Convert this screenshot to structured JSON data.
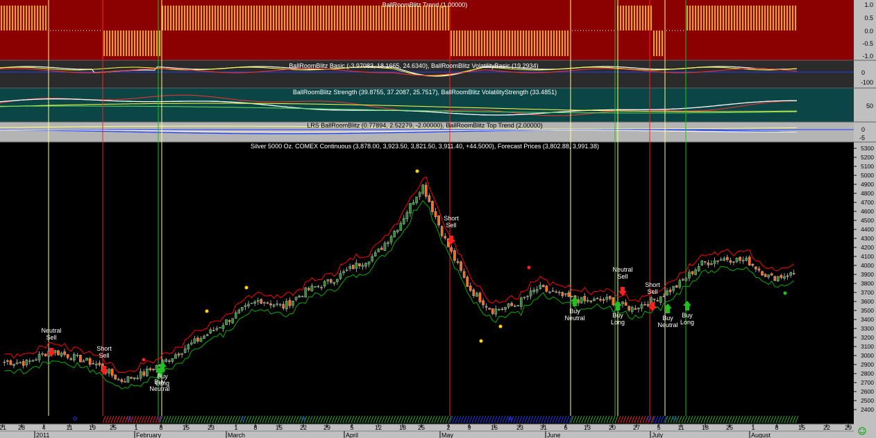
{
  "panels": {
    "trend": {
      "title": "BallRoomBlitz Trend (1.00000)",
      "scale": [
        "1.0",
        "0.5",
        "0.0",
        "-0.5",
        "-1.0"
      ],
      "bg": "#8b0000"
    },
    "basic": {
      "title": "BallRoomBlitz Basic (-3.97083, 18.1665, 24.6340), BallRoomBlitz VolatilityBasic (19.2934)",
      "scale": [
        "0",
        "-100"
      ],
      "bg": "#2b2b2b"
    },
    "strength": {
      "title": "BallRoomBlitz Strength (39.8755, 37.2087, 25.7517), BallRoomBlitz VolatilityStrength (33.4851)",
      "scale": [
        "50"
      ],
      "bg": "#0c4545"
    },
    "lrs": {
      "title": "LRS BallRoomBlitz (0.77894, 2.52279, -2.00000), BallRoomBlitz Top Trend (2.00000)",
      "scale": [
        "0",
        "-5"
      ],
      "bg": "#b4b4b4"
    }
  },
  "price": {
    "title": "Silver 5000 Oz. COMEX Continuous (3,878.00, 3,923.50, 3,821.50, 3,911.40, +44.5000), Forecast Prices (3,802.88, 3,991.38)",
    "yticks": [
      "5300",
      "5200",
      "5100",
      "5000",
      "4900",
      "4800",
      "4700",
      "4600",
      "4500",
      "4400",
      "4300",
      "4200",
      "4100",
      "4000",
      "3900",
      "3800",
      "3700",
      "3600",
      "3500",
      "3400",
      "3300",
      "3200",
      "3100",
      "3000",
      "2900",
      "2800",
      "2700",
      "2600",
      "2500",
      "2400"
    ]
  },
  "xaxis": {
    "day_ticks": [
      "21",
      "28",
      "4",
      "11",
      "19",
      "25",
      "1",
      "8",
      "15",
      "23",
      "1",
      "8",
      "15",
      "22",
      "29",
      "5",
      "12",
      "18",
      "25",
      "2",
      "9",
      "16",
      "23",
      "31",
      "6",
      "13",
      "20",
      "27",
      "5",
      "11",
      "18",
      "25",
      "1",
      "8",
      "15",
      "22",
      "29"
    ],
    "month_labels": [
      "2011",
      "February",
      "March",
      "April",
      "May",
      "June",
      "July",
      "August"
    ]
  },
  "signals": [
    {
      "id": "neutral-sell-1",
      "lines": [
        "Neutral",
        "Sell"
      ]
    },
    {
      "id": "short-sell-1",
      "lines": [
        "Short",
        "Sell"
      ]
    },
    {
      "id": "buy-neutral-1",
      "lines": [
        "Buy",
        "Neutral"
      ]
    },
    {
      "id": "buy-long-1",
      "lines": [
        "Buy",
        "Long"
      ]
    },
    {
      "id": "short-sell-2",
      "lines": [
        "Short",
        "Sell"
      ]
    },
    {
      "id": "buy-neutral-2",
      "lines": [
        "Buy",
        "Neutral"
      ]
    },
    {
      "id": "neutral-sell-2",
      "lines": [
        "Neutral",
        "Sell"
      ]
    },
    {
      "id": "buy-long-2",
      "lines": [
        "Buy",
        "Long"
      ]
    },
    {
      "id": "short-sell-3",
      "lines": [
        "Short",
        "Sell"
      ]
    },
    {
      "id": "buy-neutral-3",
      "lines": [
        "Buy",
        "Neutral"
      ]
    },
    {
      "id": "buy-long-3",
      "lines": [
        "Buy",
        "Long"
      ]
    }
  ],
  "colors": {
    "up": "#2e8b2e",
    "down": "#ff6a1a",
    "band_upper": "#ff0000",
    "band_lower": "#00b000",
    "sell_line": "#ff2020",
    "buy_line": "#20c020",
    "neutral_line": "#ffff80",
    "trend_bar": "#ffd400"
  },
  "chart_data": {
    "type": "line",
    "title": "Silver 5000 Oz. COMEX Continuous (3,878.00, 3,923.50, 3,821.50, 3,911.40, +44.5000), Forecast Prices (3,802.88, 3,991.38)",
    "ylim": [
      2400,
      5300
    ],
    "last_bar": {
      "open": 3878.0,
      "high": 3923.5,
      "low": 3821.5,
      "close": 3911.4,
      "change": 44.5
    },
    "forecast": {
      "low": 3802.88,
      "high": 3991.38
    },
    "x": [
      "Dec 21",
      "Dec 28",
      "Jan 4",
      "Jan 11",
      "Jan 19",
      "Jan 25",
      "Feb 1",
      "Feb 8",
      "Feb 15",
      "Feb 23",
      "Mar 1",
      "Mar 8",
      "Mar 15",
      "Mar 22",
      "Mar 29",
      "Apr 5",
      "Apr 12",
      "Apr 18",
      "Apr 25",
      "May 2",
      "May 9",
      "May 16",
      "May 23",
      "May 31",
      "Jun 6",
      "Jun 13",
      "Jun 20",
      "Jun 27",
      "Jul 5",
      "Jul 11",
      "Jul 18",
      "Jul 25",
      "Aug 1",
      "Aug 8",
      "Aug 15"
    ],
    "series": [
      {
        "values": [
          2930,
          2920,
          3060,
          2980,
          2900,
          2720,
          2800,
          2950,
          3120,
          3280,
          3460,
          3620,
          3540,
          3720,
          3820,
          3980,
          4120,
          4450,
          4900,
          4270,
          3750,
          3500,
          3560,
          3750,
          3660,
          3600,
          3620,
          3520,
          3620,
          3780,
          4020,
          4080,
          4050,
          3860,
          3911
        ]
      }
    ]
  }
}
